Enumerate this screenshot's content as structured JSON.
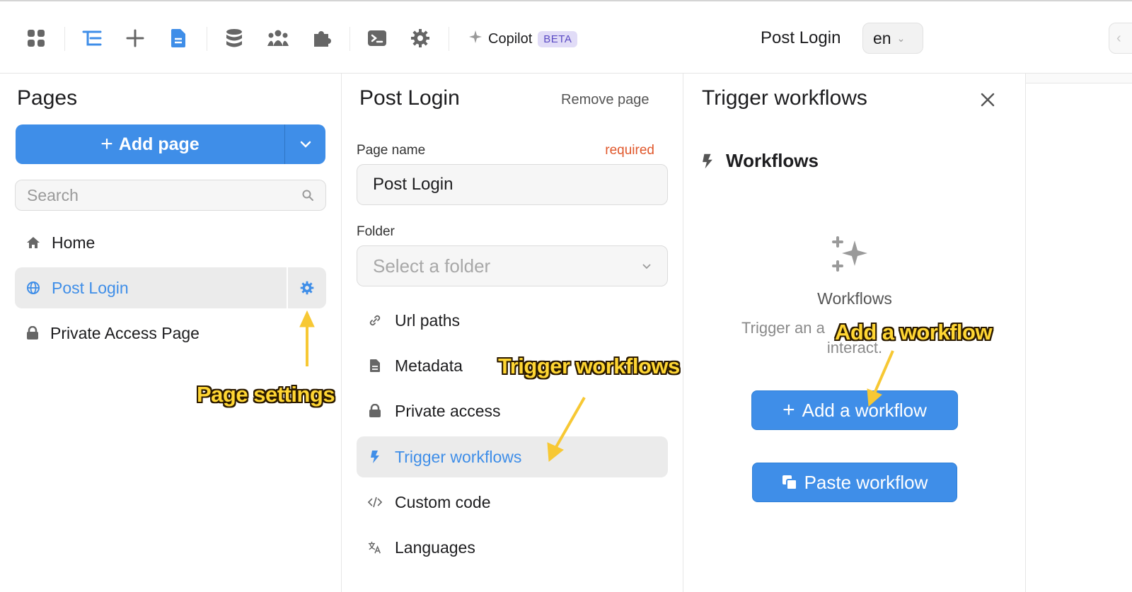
{
  "toolbar": {
    "icons": [
      "apps-grid-icon",
      "layers-icon",
      "add-icon",
      "pages-icon",
      "database-icon",
      "users-icon",
      "plugins-icon",
      "terminal-icon",
      "settings-gear-icon"
    ],
    "copilot_label": "Copilot",
    "copilot_badge": "BETA",
    "current_page": "Post Login",
    "language": "en"
  },
  "pages_panel": {
    "title": "Pages",
    "add_button": "Add page",
    "search_placeholder": "Search",
    "items": [
      {
        "label": "Home",
        "icon": "home-icon"
      },
      {
        "label": "Post Login",
        "icon": "globe-icon",
        "active": true
      },
      {
        "label": "Private Access Page",
        "icon": "lock-icon"
      }
    ]
  },
  "settings_panel": {
    "title": "Post Login",
    "remove_label": "Remove page",
    "page_name_label": "Page name",
    "required_label": "required",
    "page_name_value": "Post Login",
    "folder_label": "Folder",
    "folder_placeholder": "Select a folder",
    "menu": [
      {
        "label": "Url paths",
        "icon": "link-icon"
      },
      {
        "label": "Metadata",
        "icon": "document-icon"
      },
      {
        "label": "Private access",
        "icon": "lock-icon"
      },
      {
        "label": "Trigger workflows",
        "icon": "lightning-icon",
        "active": true
      },
      {
        "label": "Custom code",
        "icon": "code-icon"
      },
      {
        "label": "Languages",
        "icon": "translate-icon"
      }
    ]
  },
  "trigger_panel": {
    "title": "Trigger workflows",
    "section_title": "Workflows",
    "empty_title": "Workflows",
    "empty_desc_line1": "Trigger an a",
    "empty_desc_line2": "interact.",
    "add_button": "Add a workflow",
    "paste_button": "Paste workflow"
  },
  "annotations": {
    "page_settings": "Page settings",
    "trigger_workflows": "Trigger workflows",
    "add_workflow": "Add a workflow"
  },
  "colors": {
    "accent": "#3f8ee8",
    "annotation": "#ffd633",
    "required": "#e0572b"
  }
}
